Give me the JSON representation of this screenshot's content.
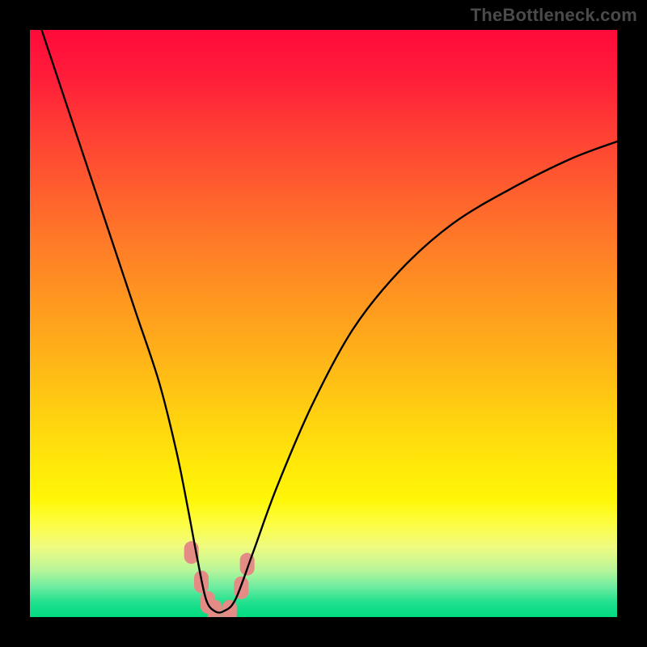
{
  "watermark": "TheBottleneck.com",
  "chart_data": {
    "type": "line",
    "title": "",
    "xlabel": "",
    "ylabel": "",
    "xlim": [
      0,
      100
    ],
    "ylim": [
      0,
      100
    ],
    "series": [
      {
        "name": "bottleneck-curve",
        "x": [
          2,
          6,
          10,
          14,
          18,
          22,
          25,
          27,
          28.5,
          30,
          31.5,
          33,
          35,
          38,
          42,
          48,
          55,
          63,
          72,
          82,
          92,
          100
        ],
        "y": [
          100,
          88,
          76,
          64,
          52,
          40,
          28,
          18,
          10,
          3,
          1,
          1,
          3,
          11,
          22,
          36,
          49,
          59,
          67,
          73,
          78,
          81
        ]
      }
    ],
    "markers": [
      {
        "name": "marker-left-upper",
        "x": 27.5,
        "y": 11,
        "color": "#e58b86"
      },
      {
        "name": "marker-left-mid",
        "x": 29.2,
        "y": 6,
        "color": "#e58b86"
      },
      {
        "name": "marker-left-lower",
        "x": 30.3,
        "y": 2.5,
        "color": "#e58b86"
      },
      {
        "name": "marker-bottom-left",
        "x": 31.5,
        "y": 1,
        "color": "#e58b86"
      },
      {
        "name": "marker-bottom-right",
        "x": 34.0,
        "y": 1,
        "color": "#e58b86"
      },
      {
        "name": "marker-right-lower",
        "x": 36.0,
        "y": 5,
        "color": "#e58b86"
      },
      {
        "name": "marker-right-upper",
        "x": 37.0,
        "y": 9,
        "color": "#e58b86"
      }
    ],
    "gradient_stops": [
      {
        "pos": 0,
        "color": "#ff0a3a"
      },
      {
        "pos": 0.5,
        "color": "#ff9720"
      },
      {
        "pos": 0.8,
        "color": "#fff707"
      },
      {
        "pos": 1.0,
        "color": "#00d980"
      }
    ]
  }
}
